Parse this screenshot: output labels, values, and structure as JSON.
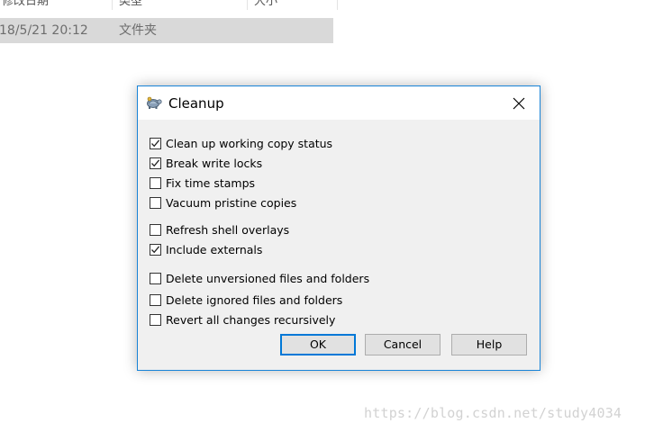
{
  "explorer": {
    "columns": [
      "修改日期",
      "类型",
      "大小"
    ],
    "row": {
      "date": "18/5/21 20:12",
      "type": "文件夹"
    }
  },
  "dialog": {
    "title": "Cleanup",
    "options": [
      {
        "label": "Clean up working copy status",
        "checked": true
      },
      {
        "label": "Break write locks",
        "checked": true
      },
      {
        "label": "Fix time stamps",
        "checked": false
      },
      {
        "label": "Vacuum pristine copies",
        "checked": false
      },
      {
        "label": "Refresh shell overlays",
        "checked": false
      },
      {
        "label": "Include externals",
        "checked": true
      },
      {
        "label": "Delete unversioned files and folders",
        "checked": false
      },
      {
        "label": "Delete ignored files and folders",
        "checked": false
      },
      {
        "label": "Revert all changes recursively",
        "checked": false
      }
    ],
    "buttons": {
      "ok": "OK",
      "cancel": "Cancel",
      "help": "Help"
    }
  },
  "watermark": "https://blog.csdn.net/study4034",
  "colors": {
    "dialog_border": "#1883d7",
    "default_button_border": "#0078d7",
    "selected_row": "#d9d9d9"
  }
}
